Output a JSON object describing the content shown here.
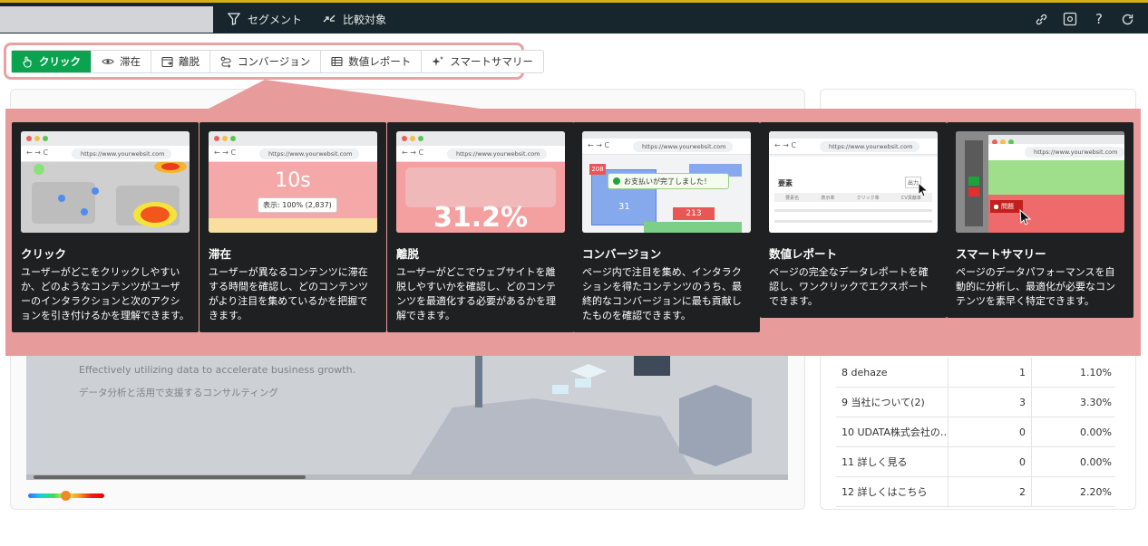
{
  "topbar": {
    "segment_label": "セグメント",
    "compare_label": "比較対象",
    "icons": [
      "link-icon",
      "settings-box-icon",
      "help-icon",
      "refresh-icon"
    ]
  },
  "tabs": [
    {
      "label": "クリック",
      "icon": "hand-pointer-icon",
      "active": true
    },
    {
      "label": "滞在",
      "icon": "eye-icon",
      "active": false
    },
    {
      "label": "離脱",
      "icon": "exit-window-icon",
      "active": false
    },
    {
      "label": "コンバージョン",
      "icon": "conversion-path-icon",
      "active": false
    },
    {
      "label": "数値レポート",
      "icon": "table-icon",
      "active": false
    },
    {
      "label": "スマートサマリー",
      "icon": "sparkles-icon",
      "active": false
    }
  ],
  "cards": [
    {
      "title": "クリック",
      "desc": "ユーザーがどこをクリックしやすいか、どのようなコンテンツがユーザーのインタラクションと次のアクションを引き付けるかを理解できます。",
      "url": "https://www.yourwebsit.com"
    },
    {
      "title": "滞在",
      "desc": "ユーザーが異なるコンテンツに滞在する時間を確認し、どのコンテンツがより注目を集めているかを把握できます。",
      "url": "https://www.yourwebsit.com",
      "big": "10s",
      "sub": "表示: 100% (2,837)"
    },
    {
      "title": "離脱",
      "desc": "ユーザーがどこでウェブサイトを離脱しやすいかを確認し、どのコンテンツを最適化する必要があるかを理解できます。",
      "url": "https://www.yourwebsit.com",
      "big": "31.2%"
    },
    {
      "title": "コンバージョン",
      "desc": "ページ内で注目を集め、インタラクションを得たコンテンツのうち、最終的なコンバージョンに最も貢献したものを確認できます。",
      "url": "https://www.yourwebsit.com",
      "toast": "お支払いが完了しました！",
      "n1": "208",
      "n2": "31",
      "n3": "213"
    },
    {
      "title": "数値レポート",
      "desc": "ページの完全なデータレポートを確認し、ワンクリックでエクスポートできます。",
      "url": "https://www.yourwebsit.com",
      "section": "要素",
      "export": "出力",
      "cols": [
        "要素名",
        "表示率",
        "クリック率",
        "CV貢献率"
      ]
    },
    {
      "title": "スマートサマリー",
      "desc": "ページのデータパフォーマンスを自動的に分析し、最適化が必要なコンテンツを素早く特定できます。",
      "url": "https://www.yourwebsit.com",
      "issue": "問題"
    }
  ],
  "preview": {
    "tagline_en": "Effectively utilizing data to accelerate business growth.",
    "tagline_jp": "データ分析と活用で支援するコンサルティング"
  },
  "table_rows": [
    {
      "name": "8 dehaze",
      "count": "1",
      "pct": "1.10%"
    },
    {
      "name": "9 当社について(2)",
      "count": "3",
      "pct": "3.30%"
    },
    {
      "name": "10 UDATA株式会社の…",
      "count": "0",
      "pct": "0.00%"
    },
    {
      "name": "11 詳しく見る",
      "count": "0",
      "pct": "0.00%"
    },
    {
      "name": "12 詳しくはこちら",
      "count": "2",
      "pct": "2.20%"
    }
  ]
}
